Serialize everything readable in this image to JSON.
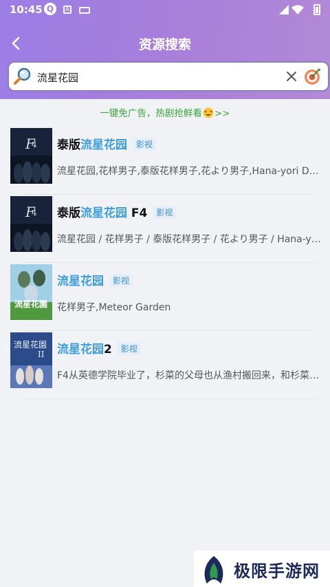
{
  "status_bar": {
    "time": "10:45"
  },
  "topbar": {
    "title": "资源搜索"
  },
  "search": {
    "value": "流星花园"
  },
  "ad": {
    "text": "一键免广告，热剧抢鲜看",
    "suffix": ">>"
  },
  "results": [
    {
      "title_prefix": "泰版",
      "title_highlight": "流星花园",
      "title_suffix": "",
      "tag": "影视",
      "desc": "流星花园,花样男子,泰版花样男子,花より男子,Hana-yori Dango"
    },
    {
      "title_prefix": "泰版",
      "title_highlight": "流星花园",
      "title_suffix": " F4",
      "tag": "影视",
      "desc": "流星花园 / 花样男子 / 泰版花样男子 / 花より男子 / Hana-yori Dango"
    },
    {
      "title_prefix": "",
      "title_highlight": "流星花园",
      "title_suffix": "",
      "tag": "影视",
      "desc": "花样男子,Meteor Garden"
    },
    {
      "title_prefix": "",
      "title_highlight": "流星花园",
      "title_suffix": "2",
      "tag": "影视",
      "desc": "F4从英德学院毕业了，杉菜的父母也从渔村搬回来，和杉菜一起生活"
    }
  ],
  "watermark": {
    "text": "极限手游网"
  },
  "colors": {
    "accent": "#9b7ee6",
    "highlight": "#3e9ddc",
    "ad_green": "#3aa53a"
  }
}
